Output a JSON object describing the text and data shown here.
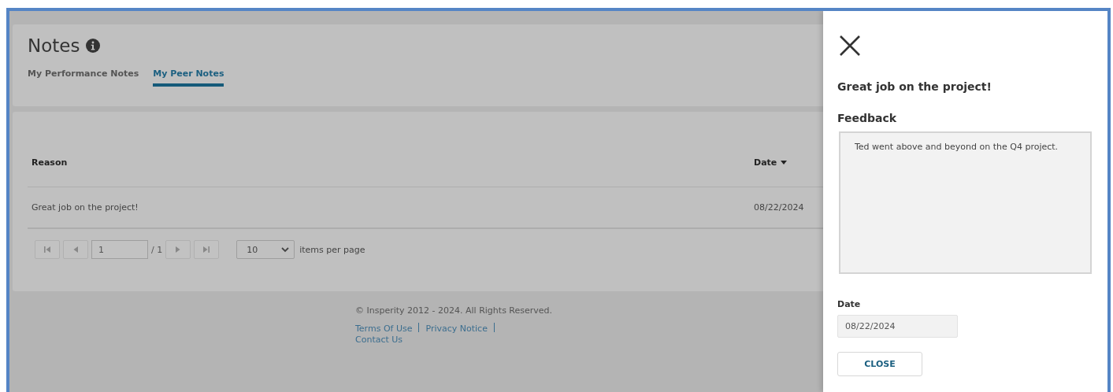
{
  "page": {
    "title": "Notes",
    "tabs": [
      {
        "label": "My Performance Notes",
        "selected": false
      },
      {
        "label": "My Peer Notes",
        "selected": true
      }
    ],
    "table": {
      "columns": [
        {
          "label": "Reason",
          "sorted": false
        },
        {
          "label": "Date",
          "sorted": true
        }
      ],
      "rows": [
        {
          "reason": "Great job on the project!",
          "date": "08/22/2024"
        }
      ]
    },
    "pager": {
      "page": "1",
      "of": "/ 1",
      "per_page": "10",
      "per_page_label": "items per page"
    },
    "footer": {
      "copyright": "© Insperity 2012 - 2024. All Rights Reserved.",
      "links": [
        "Terms Of Use",
        "Privacy Notice",
        "Contact Us"
      ]
    }
  },
  "drawer": {
    "title": "Great job on the project!",
    "feedback_label": "Feedback",
    "feedback": "Ted went above and beyond on the Q4 project.",
    "date_label": "Date",
    "date": "08/22/2024",
    "close_button": "CLOSE"
  }
}
